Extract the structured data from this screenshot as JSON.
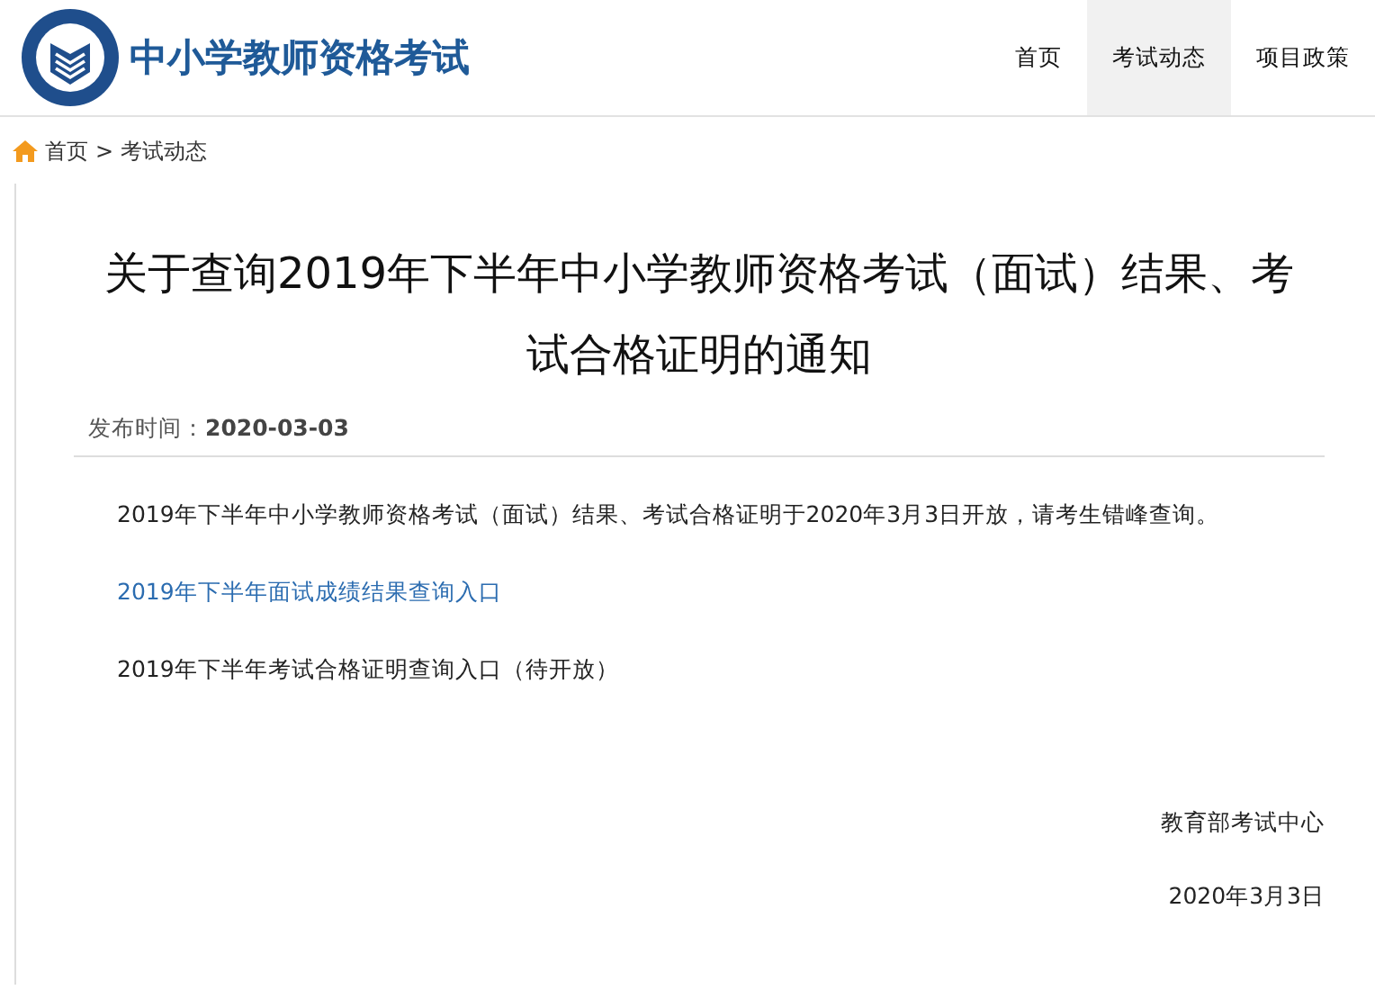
{
  "site": {
    "title": "中小学教师资格考试"
  },
  "nav": [
    {
      "label": "首页",
      "selected": false
    },
    {
      "label": "考试动态",
      "selected": true
    },
    {
      "label": "项目政策",
      "selected": false
    }
  ],
  "breadcrumb": {
    "home": "首页",
    "separator": ">",
    "current": "考试动态"
  },
  "article": {
    "title": "关于查询2019年下半年中小学教师资格考试（面试）结果、考试合格证明的通知",
    "date_label": "发布时间：",
    "date": "2020-03-03",
    "paragraphs": [
      {
        "kind": "text",
        "text": "2019年下半年中小学教师资格考试（面试）结果、考试合格证明于2020年3月3日开放，请考生错峰查询。"
      },
      {
        "kind": "link",
        "text": "2019年下半年面试成绩结果查询入口"
      },
      {
        "kind": "text",
        "text": "2019年下半年考试合格证明查询入口（待开放）"
      }
    ],
    "signature": "教育部考试中心",
    "signed_date": "2020年3月3日"
  }
}
